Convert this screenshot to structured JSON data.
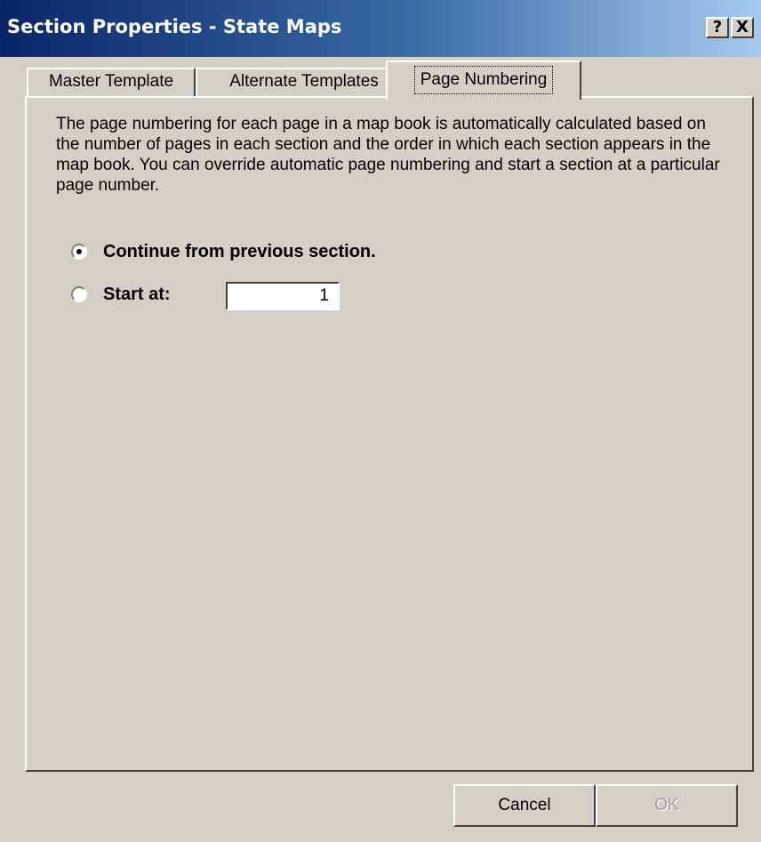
{
  "window": {
    "title": "Section Properties - State Maps",
    "help_label": "?",
    "close_label": "X"
  },
  "tabs": [
    {
      "label": "Master Template",
      "active": false
    },
    {
      "label": "Alternate Templates",
      "active": false
    },
    {
      "label": "Page Numbering",
      "active": true
    }
  ],
  "page_numbering": {
    "description": "The page numbering for each page in a map book is automatically calculated based on the number of pages in each section and the order in which each section appears in the map book.  You can override automatic page numbering and start a section at a particular page number.",
    "continue_label": "Continue from previous section.",
    "start_at_label": "Start at:",
    "start_at_value": "1",
    "selected_option": "continue"
  },
  "buttons": {
    "cancel_label": "Cancel",
    "ok_label": "OK"
  },
  "colors": {
    "title_gradient_start": "#0a246a",
    "title_gradient_end": "#a6caf0",
    "face": "#d4d0c8"
  }
}
